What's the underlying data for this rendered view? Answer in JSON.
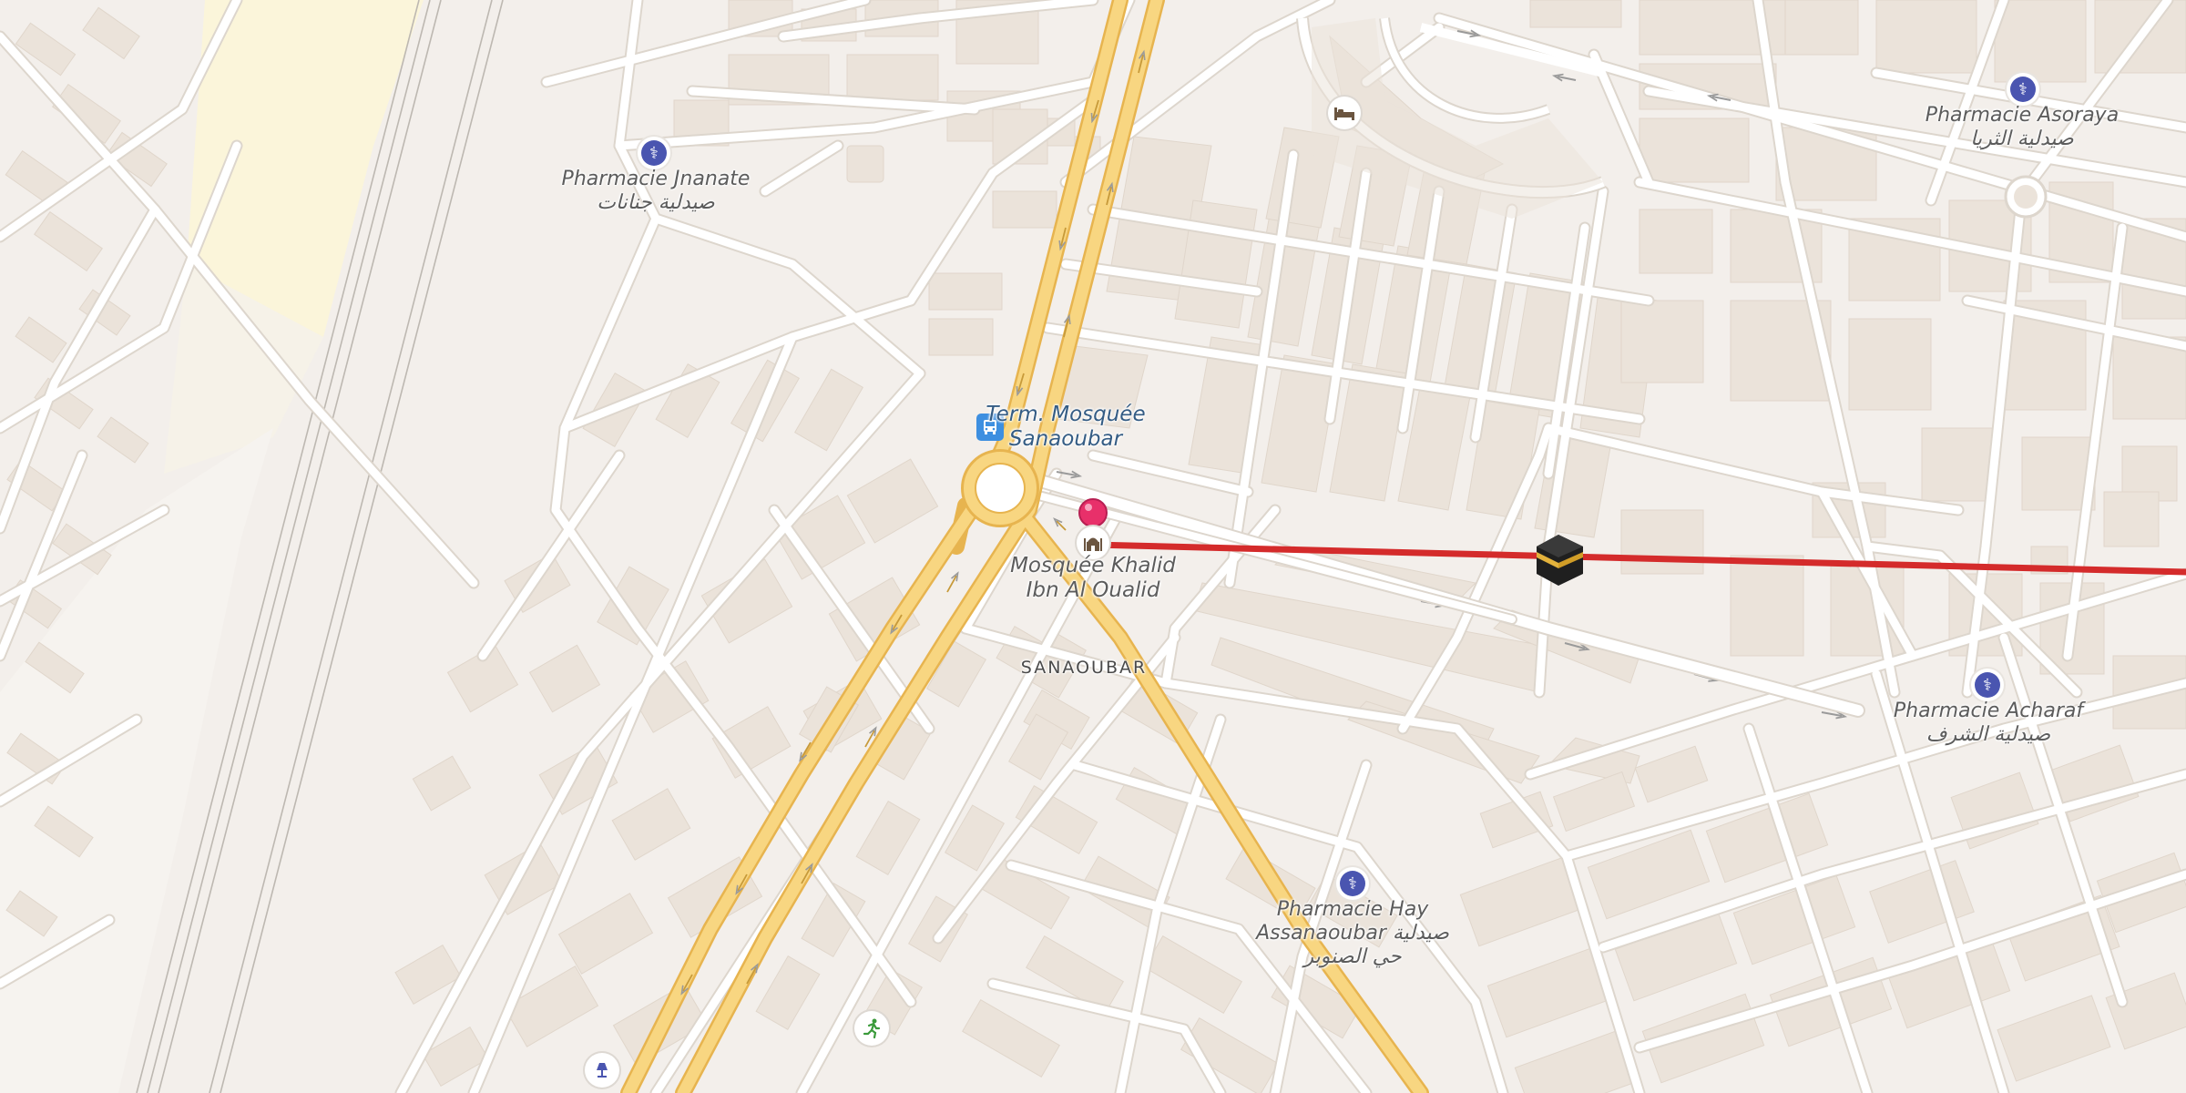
{
  "map": {
    "colors": {
      "background": "#f3efeb",
      "building": "#ebe3da",
      "minor_road": "#ffffff",
      "major_road": "#f8d681",
      "major_road_casing": "#e7b44f",
      "route_line": "#d42b2b",
      "pin": "#e8306a",
      "beach": "#fbf5da",
      "railway": "#b8b3ad"
    },
    "labels": {
      "pharmacie_jnanate": {
        "name": "Pharmacie Jnanate",
        "arabic": "صيدلية جنانات"
      },
      "pharmacie_asoraya": {
        "name": "Pharmacie Asoraya",
        "arabic": "صيدلية الثريا"
      },
      "pharmacie_acharaf": {
        "name": "Pharmacie Acharaf",
        "arabic": "صيدلية الشرف"
      },
      "pharmacie_hay": {
        "name": "Pharmacie Hay",
        "line2": "Assanaoubar صيدلية",
        "arabic": "حي الصنوبر"
      },
      "bus_stop": {
        "line1": "Term. Mosquée",
        "line2": "Sanaoubar"
      },
      "mosque": {
        "line1": "Mosquée Khalid",
        "line2": "Ibn Al Oualid"
      },
      "neighbourhood": "SANAOUBAR"
    },
    "icons": {
      "pharmacy": "pharmacy-mortar-icon",
      "hotel": "bed-icon",
      "bus": "bus-stop-icon",
      "mosque": "mosque-icon",
      "kaaba": "kaaba-icon",
      "pin": "location-pin-icon",
      "sport": "running-person-icon",
      "lamp": "lamp-icon"
    }
  }
}
